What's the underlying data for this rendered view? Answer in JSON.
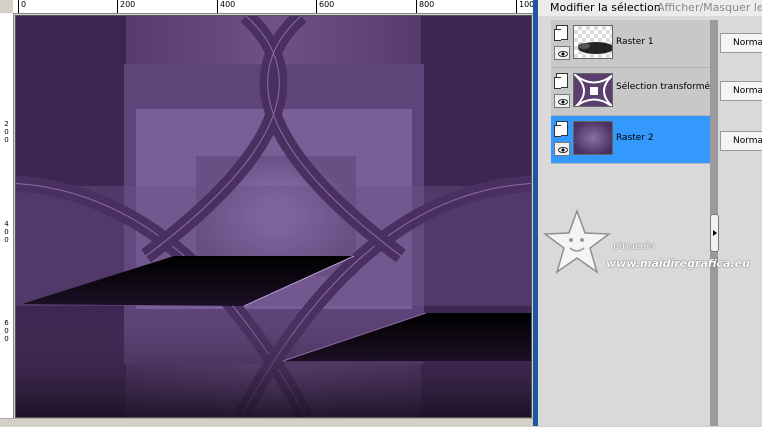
{
  "rulers": {
    "top_labels": [
      "0",
      "200",
      "400",
      "600",
      "800",
      "100"
    ],
    "left_labels": [
      "2\n0\n0",
      "4\n0\n0",
      "6\n0\n0"
    ]
  },
  "panel": {
    "toolbar": {
      "modify_selection": "Modifier la sélection",
      "show_hide": "Afficher/Masquer les c"
    },
    "layers": [
      {
        "name": "Raster 1",
        "blend_mode": "Norma",
        "selected": false,
        "thumb": "raster1-thumb"
      },
      {
        "name": "Sélection transformée",
        "blend_mode": "Norma",
        "selected": false,
        "thumb": "selection-thumb"
      },
      {
        "name": "Raster 2",
        "blend_mode": "Norma",
        "selected": true,
        "thumb": "raster2-thumb"
      }
    ]
  },
  "watermark": {
    "brand": "pinuccia",
    "url": "www.maidiregrafica.eu"
  },
  "colors": {
    "canvas_purple": "#5a3f6e",
    "canvas_light": "#8a6fa8",
    "selection_blue": "#3399ff",
    "window_border": "#1e56a0"
  }
}
